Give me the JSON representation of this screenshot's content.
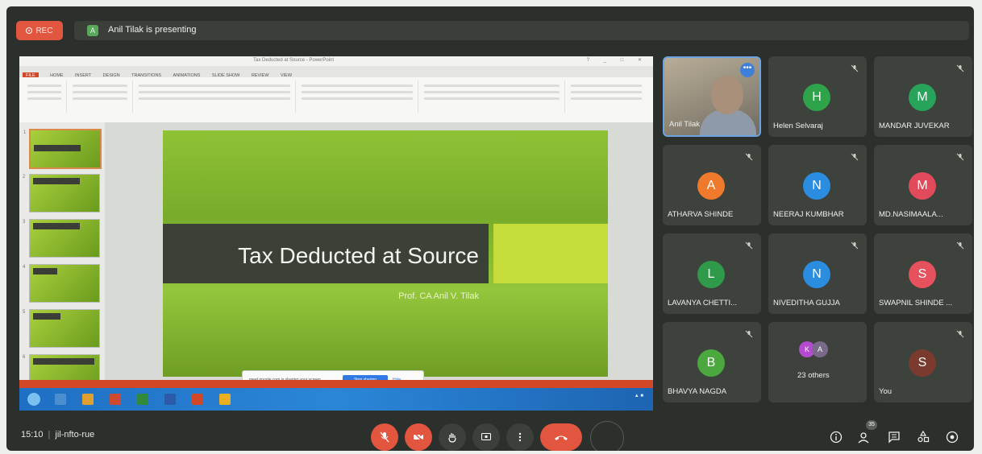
{
  "topbar": {
    "rec_label": "REC",
    "presenter_initial": "A",
    "presenting_text": "Anil Tilak is presenting"
  },
  "shared_screen": {
    "app_title": "Tax Deducted at Source - PowerPoint",
    "tabs": [
      "FILE",
      "HOME",
      "INSERT",
      "DESIGN",
      "TRANSITIONS",
      "ANIMATIONS",
      "SLIDE SHOW",
      "REVIEW",
      "VIEW"
    ],
    "slide_title": "Tax Deducted at Source",
    "slide_subtitle": "Prof. CA Anil V. Tilak",
    "slide_numbers": [
      "1",
      "2",
      "3",
      "4",
      "5",
      "6"
    ],
    "share_message": "meet.google.com is sharing your screen.",
    "stop_sharing_label": "Stop sharing",
    "hide_label": "Hide"
  },
  "participants": [
    {
      "name": "Anil Tilak",
      "type": "video"
    },
    {
      "name": "Helen Selvaraj",
      "initial": "H",
      "color": "#2fa34a"
    },
    {
      "name": "MANDAR JUVEKAR",
      "initial": "M",
      "color": "#27a35a"
    },
    {
      "name": "ATHARVA SHINDE",
      "initial": "A",
      "color": "#ef7a2c"
    },
    {
      "name": "NEERAJ KUMBHAR",
      "initial": "N",
      "color": "#2a8de0"
    },
    {
      "name": "MD.NASIMAALA...",
      "initial": "M",
      "color": "#e04a5a"
    },
    {
      "name": "LAVANYA CHETTI...",
      "initial": "L",
      "color": "#2f9a4a"
    },
    {
      "name": "NIVEDITHA GUJJA",
      "initial": "N",
      "color": "#2a8de0"
    },
    {
      "name": "SWAPNIL SHINDE ...",
      "initial": "S",
      "color": "#e5525e"
    },
    {
      "name": "BHAVYA NAGDA",
      "initial": "B",
      "color": "#4aa83e"
    },
    {
      "name": "23 others",
      "initials": [
        "K",
        "A"
      ],
      "colors": [
        "#b34ad0",
        "#7a6a8a"
      ]
    },
    {
      "name": "You",
      "initial": "S",
      "color": "#7a3a2e"
    }
  ],
  "bottombar": {
    "time": "15:10",
    "meeting_code": "jil-nfto-rue",
    "participant_count": "35"
  },
  "colors": {
    "accent_red": "#e2553e",
    "tile_bg": "#3d423d",
    "bar_bg": "#2c302c"
  }
}
